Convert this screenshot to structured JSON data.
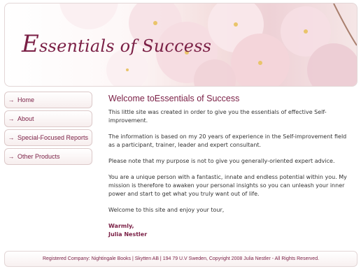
{
  "header": {
    "logo_initial": "E",
    "logo_rest": "ssentials of Success",
    "colors": {
      "accent": "#7a1f45",
      "petal": "#f3dce0"
    }
  },
  "nav": {
    "items": [
      {
        "label": "Home",
        "icon": "arrow-icon"
      },
      {
        "label": "About",
        "icon": "arrow-icon"
      },
      {
        "label": "Special-Focused Reports",
        "icon": "arrow-icon"
      },
      {
        "label": "Other Products",
        "icon": "arrow-icon"
      }
    ]
  },
  "main": {
    "title": "Welcome toEssentials of Success",
    "paragraphs": [
      "This little site was created in order to give you the essentials of effective Self-improvement.",
      "The information is based on my 20 years of experience in the Self-improvement field as a participant, trainer, leader and expert consultant.",
      "Please note that my purpose is not to give you generally-oriented expert advice.",
      "You are a unique person with a fantastic, innate and endless potential within you. My mission is therefore to awaken your personal insights so you can unleash your inner power and start to get what you truly want out of life.",
      "Welcome to this site and enjoy your tour,"
    ],
    "signoff": "Warmly,",
    "author": "Julia Nestler"
  },
  "footer": {
    "text": "Registered Company: Nightingale Books | Skytten AB | 194 79 U.V Sweden, Copyright 2008 Julia Nestler - All Rights Reserved."
  }
}
